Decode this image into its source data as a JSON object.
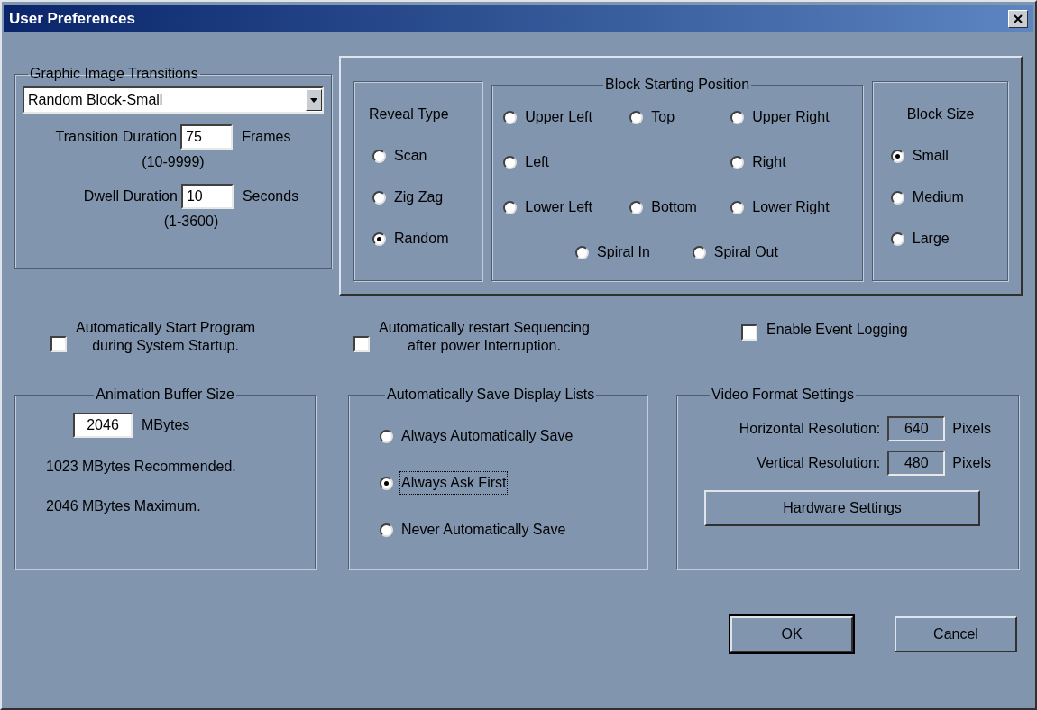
{
  "window": {
    "title": "User Preferences"
  },
  "transitions": {
    "label": "Graphic Image Transitions",
    "dropdown": {
      "value": "Random Block-Small"
    },
    "fields": [
      {
        "label": "Transition Duration",
        "value": "75",
        "unit": "Frames",
        "range": "(10-9999)"
      },
      {
        "label": "Dwell Duration",
        "value": "10",
        "unit": "Seconds",
        "range": "(1-3600)"
      }
    ]
  },
  "reveal_type": {
    "label": "Reveal Type",
    "options": [
      {
        "label": "Scan",
        "selected": false
      },
      {
        "label": "Zig Zag",
        "selected": false
      },
      {
        "label": "Random",
        "selected": true
      }
    ]
  },
  "block_position": {
    "label": "Block Starting Position",
    "options": [
      {
        "label": "Upper Left",
        "selected": false
      },
      {
        "label": "Top",
        "selected": false
      },
      {
        "label": "Upper Right",
        "selected": false
      },
      {
        "label": "Left",
        "selected": false
      },
      {
        "label": "Right",
        "selected": false
      },
      {
        "label": "Lower Left",
        "selected": false
      },
      {
        "label": "Bottom",
        "selected": false
      },
      {
        "label": "Lower Right",
        "selected": false
      },
      {
        "label": "Spiral In",
        "selected": false
      },
      {
        "label": "Spiral Out",
        "selected": false
      }
    ]
  },
  "block_size": {
    "label": "Block Size",
    "options": [
      {
        "label": "Small",
        "selected": true
      },
      {
        "label": "Medium",
        "selected": false
      },
      {
        "label": "Large",
        "selected": false
      }
    ]
  },
  "checkboxes": [
    {
      "lines": [
        "Automatically Start Program",
        "during System Startup."
      ],
      "checked": false
    },
    {
      "lines": [
        "Automatically restart Sequencing",
        "after power Interruption."
      ],
      "checked": false
    },
    {
      "lines": [
        "Enable Event Logging"
      ],
      "checked": false
    }
  ],
  "buffer": {
    "label": "Animation Buffer Size",
    "value": "2046",
    "unit": "MBytes",
    "notes": [
      "1023 MBytes Recommended.",
      "2046 MBytes Maximum."
    ]
  },
  "autosave": {
    "label": "Automatically Save Display Lists",
    "options": [
      {
        "label": "Always Automatically Save",
        "selected": false,
        "focused": false
      },
      {
        "label": "Always Ask First",
        "selected": true,
        "focused": true
      },
      {
        "label": "Never Automatically Save",
        "selected": false,
        "focused": false
      }
    ]
  },
  "video": {
    "label": "Video Format Settings",
    "fields": [
      {
        "label": "Horizontal Resolution:",
        "value": "640",
        "unit": "Pixels",
        "disabled": true
      },
      {
        "label": "Vertical Resolution:",
        "value": "480",
        "unit": "Pixels",
        "disabled": true
      }
    ],
    "button": "Hardware Settings"
  },
  "buttons": [
    {
      "label": "OK",
      "default": true
    },
    {
      "label": "Cancel",
      "default": false
    }
  ]
}
